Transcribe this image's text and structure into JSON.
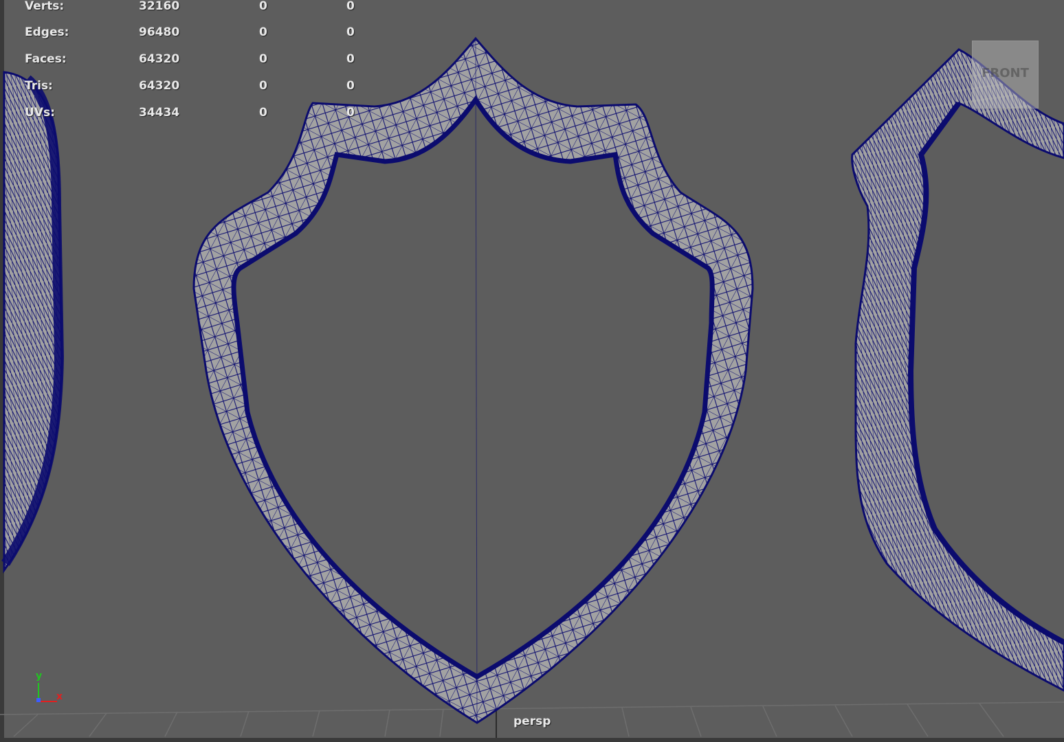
{
  "app": {
    "camera": "persp",
    "view_cube_label": "FRONT"
  },
  "hud": {
    "rows": [
      {
        "label": "Verts:",
        "values": [
          "32160",
          "0",
          "0"
        ]
      },
      {
        "label": "Edges:",
        "values": [
          "96480",
          "0",
          "0"
        ]
      },
      {
        "label": "Faces:",
        "values": [
          "64320",
          "0",
          "0"
        ]
      },
      {
        "label": "Tris:",
        "values": [
          "64320",
          "0",
          "0"
        ]
      },
      {
        "label": "UVs:",
        "values": [
          "34434",
          "0",
          "0"
        ]
      }
    ]
  },
  "axis": {
    "y_label": "y",
    "x_label": "x"
  },
  "colors": {
    "background": "#5d5d5d",
    "wireframe": "#0b0b6e",
    "surface": "#a2a2a2",
    "grid": "#6e6e6e",
    "text": "#e9e9e9",
    "axis_x": "#e02020",
    "axis_y": "#22c422",
    "axis_z": "#3d5cff"
  },
  "icons": {
    "view_cube": "view-cube-icon",
    "axis_gizmo": "axis-gizmo-icon"
  }
}
